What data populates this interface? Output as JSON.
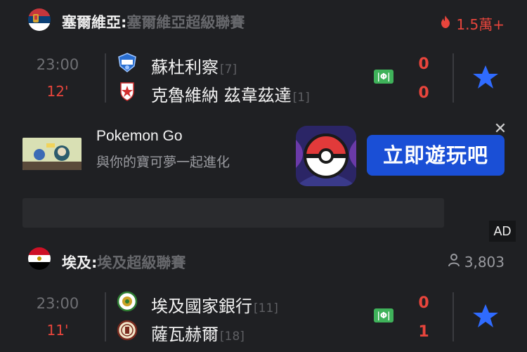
{
  "leagues": [
    {
      "country": "塞爾維亞:",
      "league": "塞爾維亞超級聯賽",
      "stat": "1.5萬+",
      "stat_color": "#e8453c",
      "stat_icon": "flame-icon",
      "match": {
        "time": "23:00",
        "minute": "12'",
        "home": {
          "name": "蘇杜利察",
          "rank": "[7]",
          "score": "0"
        },
        "away": {
          "name": "克魯維納 茲韋茲達",
          "rank": "[1]",
          "score": "0"
        },
        "odds_badge": "|Φ|"
      }
    },
    {
      "country": "埃及:",
      "league": "埃及超級聯賽",
      "stat": "3,803",
      "stat_color": "#9a9ba0",
      "stat_icon": "person-icon",
      "match": {
        "time": "23:00",
        "minute": "11'",
        "home": {
          "name": "埃及國家銀行",
          "rank": "[11]",
          "score": "0"
        },
        "away": {
          "name": "薩瓦赫爾",
          "rank": "[18]",
          "score": "1"
        },
        "odds_badge": "|Φ|"
      }
    }
  ],
  "ad": {
    "title": "Pokemon Go",
    "subtitle": "與你的寶可夢一起進化",
    "cta": "立即遊玩吧",
    "close": "✕",
    "label": "AD"
  },
  "colors": {
    "accent_red": "#e8453c",
    "star_blue": "#2f6bff",
    "cta_blue": "#1a4fd6",
    "odds_green": "#3fb25a"
  }
}
